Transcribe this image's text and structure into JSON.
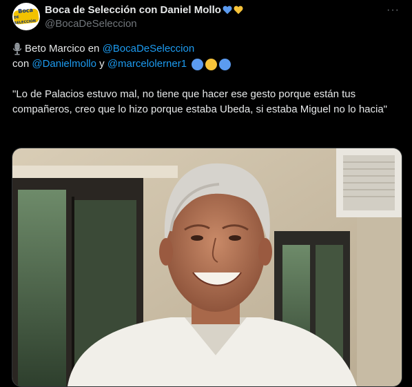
{
  "header": {
    "display_name": "Boca de Selección con Daniel Mollo",
    "handle": "@BocaDeSeleccion",
    "avatar_text_top": "Boca",
    "avatar_text_bottom": "DE SELECCIÓN",
    "more_label": "···",
    "badge_icons": [
      "blue-heart-icon",
      "yellow-heart-icon"
    ]
  },
  "tweet": {
    "line1_prefix": "Beto Marcico en",
    "line1_mention": "@BocaDeSeleccion",
    "line2_con": "con",
    "line2_mention1": "@Danielmollo",
    "line2_y": "y",
    "line2_mention2": "@marcelolerner1",
    "quote": "\"Lo de Palacios estuvo mal, no tiene que hacer ese gesto porque están tus compañeros, creo que lo hizo porque estaba Ubeda, si estaba Miguel no lo hacia\""
  },
  "colors": {
    "accent": "#1d9bf0",
    "blue_circle": "#5b9bf0",
    "yellow_circle": "#f6c33a"
  }
}
